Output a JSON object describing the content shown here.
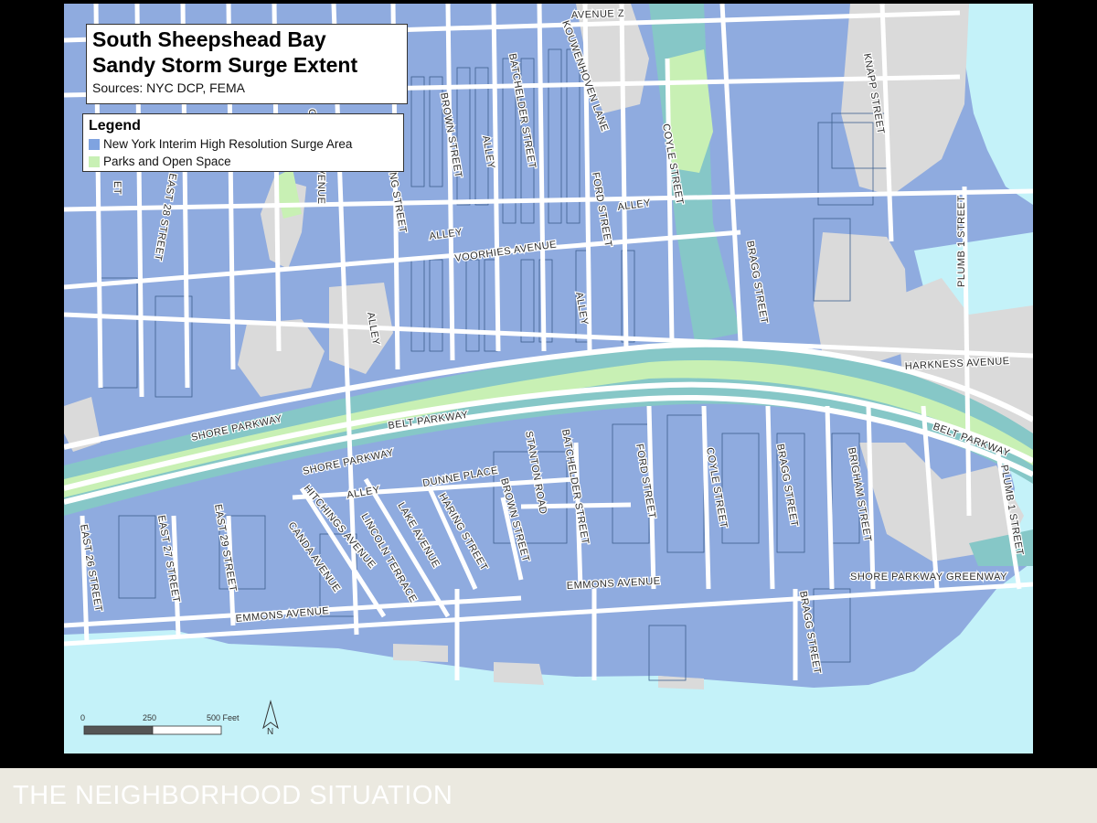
{
  "map": {
    "title_line1": "South Sheepshead Bay",
    "title_line2": "Sandy Storm Surge Extent",
    "sources": "Sources: NYC DCP, FEMA",
    "legend": {
      "heading": "Legend",
      "items": [
        {
          "label": "New York Interim High Resolution Surge Area",
          "color": "#7fa3e0"
        },
        {
          "label": "Parks and Open Space",
          "color": "#c8f0b4"
        }
      ]
    },
    "scale_bar": {
      "ticks": [
        "0",
        "250",
        "500 Feet"
      ]
    },
    "north_arrow_label": "N",
    "street_labels": [
      "AVENUE Z",
      "KOUWENHOVEN LANE",
      "BATCHELDER STREET",
      "BROWN STREET",
      "ALLEY",
      "FORD STREET",
      "COYLE STREET",
      "KNAPP STREET",
      "EAST 28 STREET",
      "NG STREET",
      "VOORHIES AVENUE",
      "BRAGG STREET",
      "PLUMB 1 STREET",
      "HARKNESS AVENUE",
      "SHORE PARKWAY",
      "BELT PARKWAY",
      "DUNNE PLACE",
      "STANTON ROAD",
      "HARING STREET",
      "BRIGHAM STREET",
      "HITCHINGS AVENUE",
      "LINCOLN TERRACE",
      "LAKE AVENUE",
      "CANDA AVENUE",
      "EAST 29 STREET",
      "EAST 27 STREET",
      "EAST 26 STREET",
      "EMMONS AVENUE",
      "SHORE PARKWAY GREENWAY",
      "ET",
      "AVENUE",
      "O"
    ]
  },
  "colors": {
    "surge_blue": "#8fabdf",
    "water": "#c4f2f9",
    "park_green": "#c8f0b4",
    "dry_land": "#dadada",
    "road": "#ffffff",
    "parkway_teal": "#86c7c7"
  },
  "footer": {
    "title": "THE NEIGHBORHOOD SITUATION"
  }
}
